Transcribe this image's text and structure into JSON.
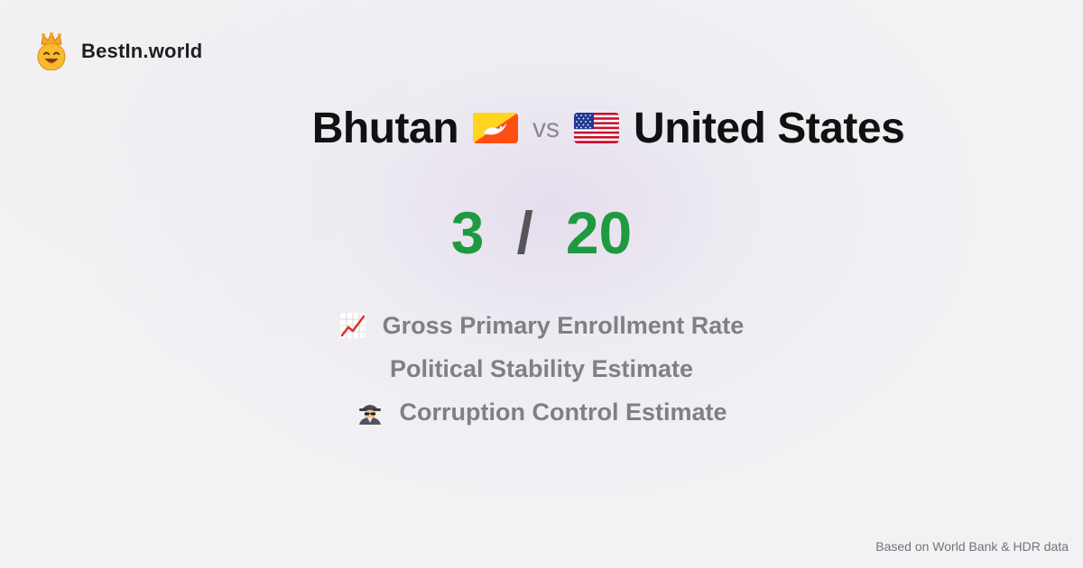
{
  "brand": {
    "name": "BestIn.world",
    "logo_icon": "crowned-smiley-icon"
  },
  "comparison": {
    "country_a": {
      "name": "Bhutan",
      "flag_icon": "bhutan-flag-icon"
    },
    "vs_label": "vs",
    "country_b": {
      "name": "United States",
      "flag_icon": "united-states-flag-icon"
    }
  },
  "score": {
    "value_a": "3",
    "separator": "/",
    "value_b": "20",
    "color": "#1f9a41"
  },
  "metrics": [
    {
      "label": "Gross Primary Enrollment Rate",
      "icon": "chart-increasing-icon"
    },
    {
      "label": "Political Stability Estimate",
      "icon": ""
    },
    {
      "label": "Corruption Control Estimate",
      "icon": "detective-icon"
    }
  ],
  "footer": {
    "source_note": "Based on World Bank & HDR data"
  }
}
